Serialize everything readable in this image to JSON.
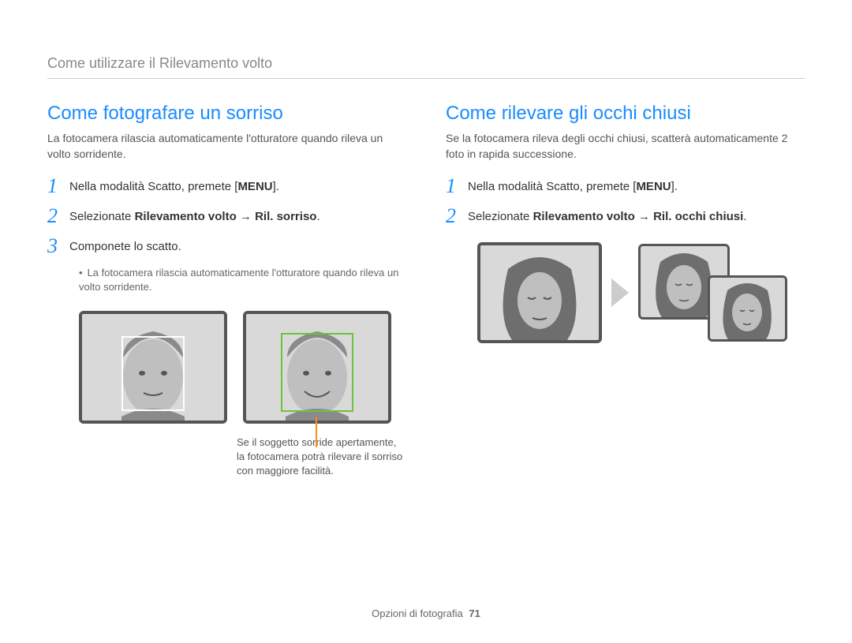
{
  "header": "Come utilizzare il Rilevamento volto",
  "left": {
    "title": "Come fotografare un sorriso",
    "intro": "La fotocamera rilascia automaticamente l'otturatore quando rileva un volto sorridente.",
    "steps": [
      {
        "num": "1",
        "pre": "Nella modalità Scatto, premete [",
        "menu": "MENU",
        "post": "]."
      },
      {
        "num": "2",
        "pre": "Selezionate ",
        "bold": "Rilevamento volto → Ril. sorriso",
        "post": "."
      },
      {
        "num": "3",
        "pre": "Componete lo scatto."
      }
    ],
    "bullet": "La fotocamera rilascia automaticamente l'otturatore quando rileva un volto sorridente.",
    "caption": "Se il soggetto sorride apertamente, la fotocamera potrà rilevare il sorriso con maggiore facilità."
  },
  "right": {
    "title": "Come rilevare gli occhi chiusi",
    "intro": "Se la fotocamera rileva degli occhi chiusi, scatterà automaticamente 2 foto in rapida successione.",
    "steps": [
      {
        "num": "1",
        "pre": "Nella modalità Scatto, premete [",
        "menu": "MENU",
        "post": "]."
      },
      {
        "num": "2",
        "pre": "Selezionate ",
        "bold": "Rilevamento volto → Ril. occhi chiusi",
        "post": "."
      }
    ]
  },
  "footer": {
    "section": "Opzioni di fotografia",
    "page": "71"
  }
}
